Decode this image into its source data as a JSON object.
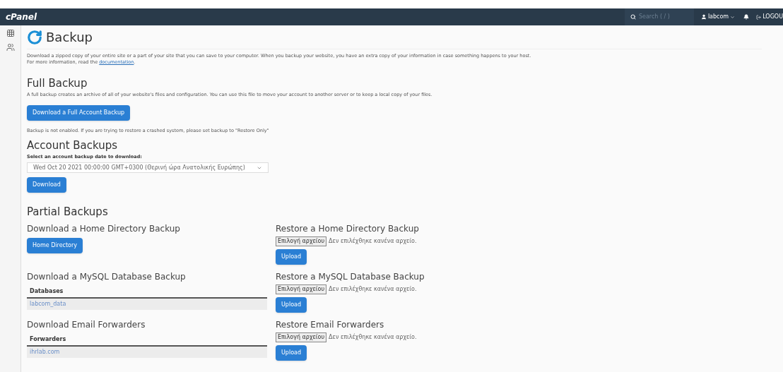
{
  "topbar": {
    "logo": "cPanel",
    "search_placeholder": "Search ( / )",
    "user": "labcom",
    "logout": "LOGOU"
  },
  "page": {
    "title": "Backup",
    "intro": "Download a zipped copy of your entire site or a part of your site that you can save to your computer. When you backup your website, you have an extra copy of your information in case something happens to your host.",
    "intro_more": "For more information, read the",
    "intro_link": "documentation",
    "intro_end": "."
  },
  "full_backup": {
    "heading": "Full Backup",
    "description": "A full backup creates an archive of all of your website's files and configuration. You can use this file to move your account to another server or to keep a local copy of your files.",
    "button": "Download a Full Account Backup",
    "notice": "Backup is not enabled. If you are trying to restore a crashed system, please set backup to \"Restore Only\""
  },
  "account_backups": {
    "heading": "Account Backups",
    "label": "Select an account backup date to download:",
    "selected": "Wed Oct 20 2021 00:00:00 GMT+0300 (Θερινή ώρα Ανατολικής Ευρώπης)",
    "button": "Download"
  },
  "partial": {
    "heading": "Partial Backups",
    "download": [
      {
        "kind": "button",
        "heading": "Download a Home Directory Backup",
        "button": "Home Directory"
      },
      {
        "kind": "table",
        "heading": "Download a MySQL Database Backup",
        "column": "Databases",
        "rows": [
          "labcom_data"
        ]
      },
      {
        "kind": "table",
        "heading": "Download Email Forwarders",
        "column": "Forwarders",
        "rows": [
          "ihrlab.com"
        ]
      }
    ],
    "restore": [
      {
        "heading": "Restore a Home Directory Backup",
        "file_button": "Επιλογή αρχείου",
        "file_status": "Δεν επιλέχθηκε κανένα αρχείο.",
        "button": "Upload"
      },
      {
        "heading": "Restore a MySQL Database Backup",
        "file_button": "Επιλογή αρχείου",
        "file_status": "Δεν επιλέχθηκε κανένα αρχείο.",
        "button": "Upload"
      },
      {
        "heading": "Restore Email Forwarders",
        "file_button": "Επιλογή αρχείου",
        "file_status": "Δεν επιλέχθηκε κανένα αρχείο.",
        "button": "Upload"
      }
    ]
  }
}
